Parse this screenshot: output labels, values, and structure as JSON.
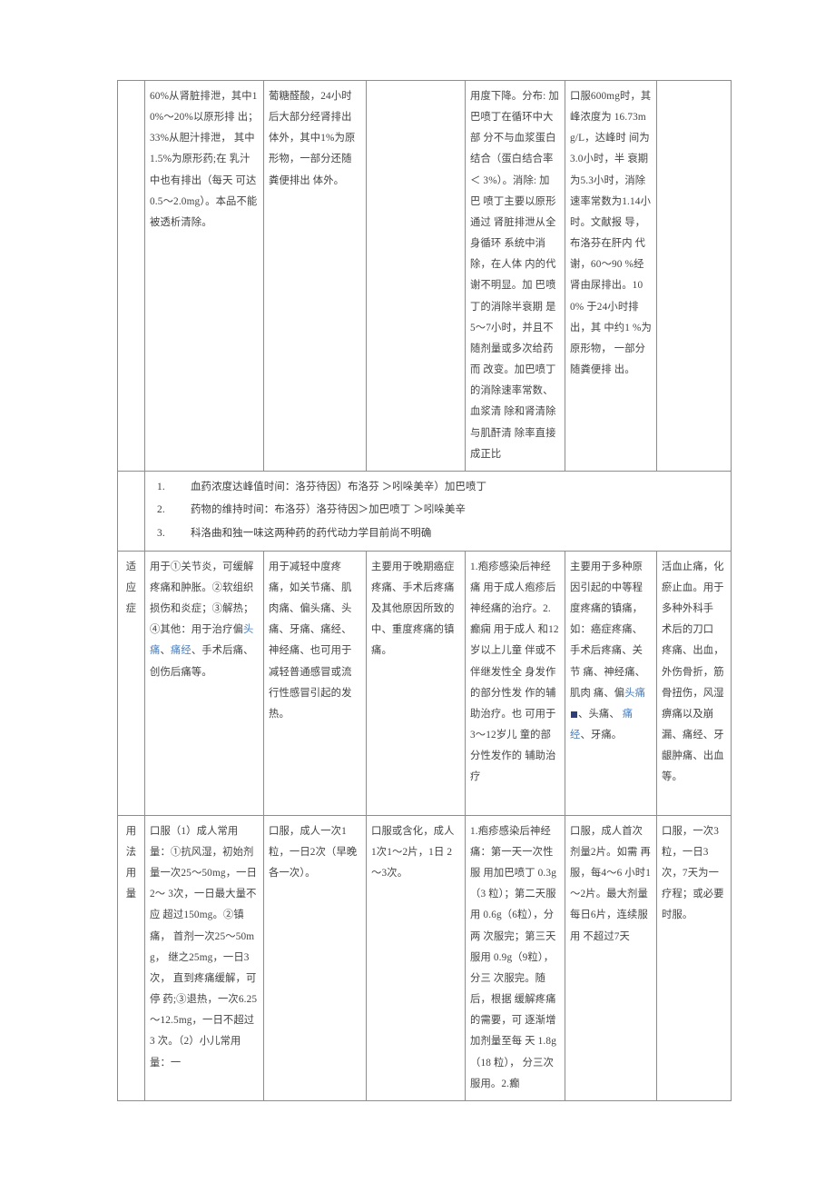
{
  "document": {
    "type": "pharmacology comparison table",
    "table": {
      "columns": 7,
      "rows": [
        {
          "name": "pharmacokinetics-continued",
          "label": "",
          "cells": [
            "60%从肾脏排泄，其中10%～20%以原形排 出；33%从胆汁排泄， 其中1.5%为原形药;在 乳汁中也有排出（每天 可达0.5～2.0mg）。本品不能被透析清除。",
            "葡糖醛酸，24小时后大部分经肾排出体外，其中1%为原形物，一部分还随粪便排出 体外。",
            "",
            "用度下降。分布: 加 巴喷丁在循环中大部 分不与血浆蛋白结合（蛋白结合率＜ 3%）。消除: 加巴 喷丁主要以原形通过 肾脏排泄从全身循环 系统中消除，在人体 内的代谢不明显。加 巴喷丁的消除半衰期 是5～7小时，并且不 随剂量或多次给药 而 改变。加巴喷丁的消除速率常数、血浆清 除和肾清除与肌酐清 除率直接成正比",
            "口服600mg时，其 峰浓度为 16.73mg/L，达峰时 间为3.0小时，半 衰期为5.3小时，消除速率常数为1.14小时。文献报 导，布洛芬在肝内 代谢，60～90 %经 肾由尿排出。100% 于24小时排出，其 中约1 %为原形物， 一部分随粪便排 出。",
            "",
            ""
          ]
        },
        {
          "name": "summary-notes",
          "label": "",
          "notes": [
            {
              "num": "1.",
              "text": "血药浓度达峰值时间：洛芬待因）布洛芬 ＞吲哚美辛）加巴喷丁"
            },
            {
              "num": "2.",
              "text": "药物的维持时间：布洛芬）洛芬待因＞加巴喷丁 ＞吲哚美辛"
            },
            {
              "num": "3.",
              "text": "科洛曲和独一味这两种药的药代动力学目前尚不明确"
            }
          ]
        },
        {
          "name": "indications",
          "label": "适应症",
          "cells": [
            {
              "segments": [
                {
                  "text": "用于①关节炎，可缓解疼痛和肿胀。②软组织损伤和炎症；③解热；④其他：用于治疗偏",
                  "link": false
                },
                {
                  "text": "头痛",
                  "link": true
                },
                {
                  "text": "、",
                  "link": false
                },
                {
                  "text": "痛经",
                  "link": true
                },
                {
                  "text": "、手术后痛、创伤后痛等。",
                  "link": false
                }
              ]
            },
            {
              "segments": [
                {
                  "text": "用于减轻中度疼 痛，如关节痛、肌 肉痛、偏头痛、头 痛、牙痛、痛经、 神经痛、也可用于 减轻普通感冒或流 行性感冒引起的发 热。",
                  "link": false
                }
              ]
            },
            {
              "segments": [
                {
                  "text": "主要用于晚期癌症疼痛、手术后疼痛 及其他原因所致的 中、重度疼痛的镇 痛。",
                  "link": false
                }
              ]
            },
            {
              "segments": [
                {
                  "text": "1.疱疹感染后神经痛 用于成人疱疹后神经痛的治疗。2.癫痫 用于成人 和12岁以上儿童 伴或不伴继发性全 身发作的部分性发 作的辅助治疗。也 可用于3～12岁儿 童的部分性发作的 辅助治疗",
                  "link": false
                }
              ]
            },
            {
              "segments": [
                {
                  "text": "主要用于多种原 因引起的中等程 度疼痛的镇痛， 如：癌症疼痛、 手术后疼痛、关节 痛、神经痛、肌肉 痛、偏",
                  "link": false
                },
                {
                  "text": "头痛",
                  "link": true
                },
                {
                  "marker": true
                },
                {
                  "text": "、头痛、 ",
                  "link": false
                },
                {
                  "text": "痛经",
                  "link": true
                },
                {
                  "text": "、牙痛。",
                  "link": false
                }
              ]
            },
            {
              "segments": [
                {
                  "text": "活血止痛，化瘀止血。用于多种外科手 术后的刀口 疼痛、出血， 外伤骨折，筋 骨扭伤，风湿 痹痛以及崩 漏、痛经、牙 龈肿痛、出血 等。",
                  "link": false
                }
              ]
            }
          ]
        },
        {
          "name": "dosage-and-administration",
          "label": "用法用量",
          "cells": [
            "口服（1）成人常用量：①抗风湿，初始剂量一次25～50mg，一日2～ 3次，一日最大量不应 超过150mg。②镇痛， 首剂一次25～50mg， 继之25mg，一日3次， 直到疼痛缓解，可停 药;③退热，一次6.25～12.5mg，一日不超过3 次。（2）小儿常用量：一",
            "口服，成人一次1粒，一日2次（早晚 各一次）。",
            "口服或含化，成人 1次1～2片，1日 2～3次。",
            "1.疱疹感染后神经 痛：第一天一次性服 用加巴喷丁 0.3g（3 粒）；第二天服用 0.6g（6粒），分两 次服完；第三天服用 0.9g（9粒），分三 次服完。随后，根据 缓解疼痛的需要，可 逐渐增加剂量至每 天 1.8g（18 粒）， 分三次服用。2.癫",
            "口服，成人首次 剂量2片。如需 再服，每4～6 小时1～2片。最大剂量每日6片，连续服用 不超过7天",
            "口服，一次3粒，一日3次，7天为一疗程；或必要时服。"
          ]
        }
      ]
    }
  },
  "colors": {
    "link": "#4a7ebb",
    "text": "#434343",
    "border": "#8d8d8d",
    "marker": "#2c3f7a"
  }
}
